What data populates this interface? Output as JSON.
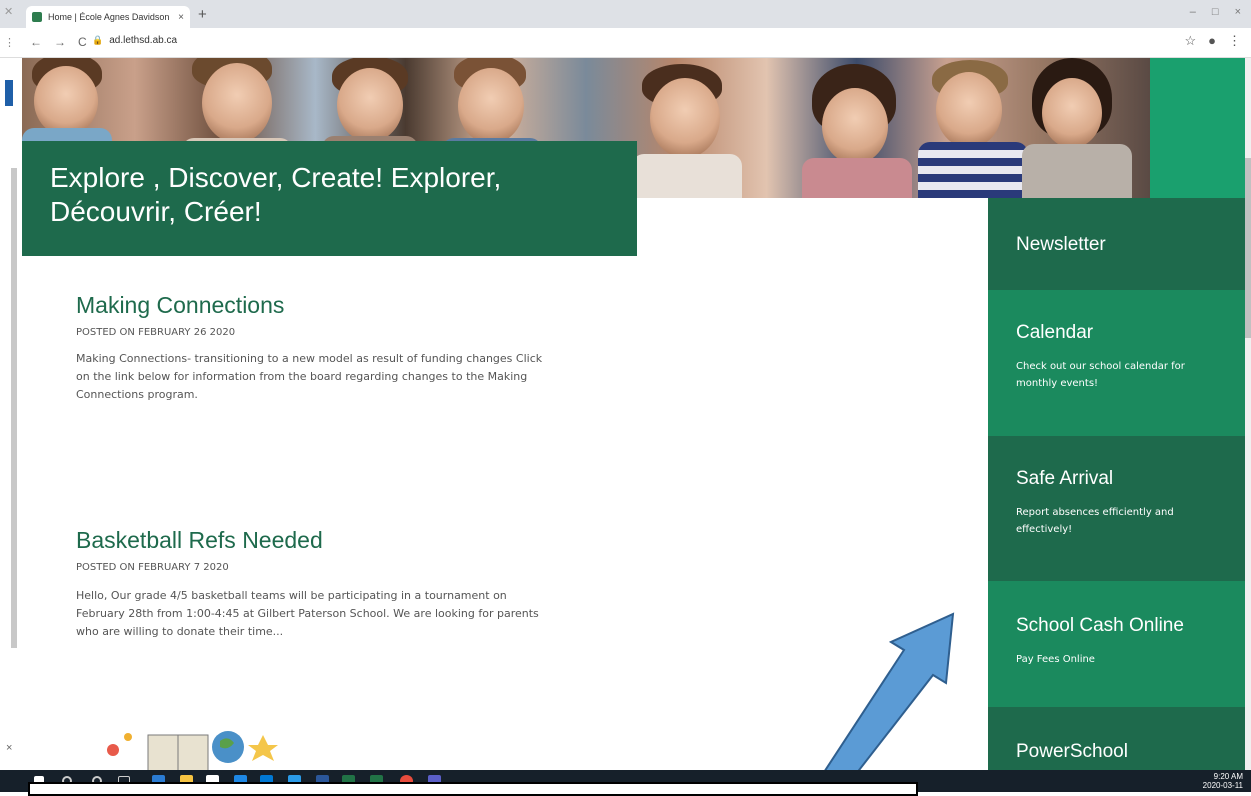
{
  "browser": {
    "tab_title": "Home | École Agnes Davidson",
    "tab_close": "×",
    "new_tab": "+",
    "url": "ad.lethsd.ab.ca",
    "window_controls": [
      "–",
      "□",
      "×"
    ]
  },
  "hero": {
    "banner_text": "Explore , Discover, Create! Explorer, Découvrir, Créer!"
  },
  "posts": [
    {
      "title": "Making Connections",
      "date": "POSTED ON FEBRUARY 26 2020",
      "excerpt": "Making Connections- transitioning to a new model as result of funding changes Click on the link below for information from the board regarding changes to the Making Connections program."
    },
    {
      "title": "Basketball Refs Needed",
      "date": "POSTED ON FEBRUARY 7 2020",
      "excerpt": "Hello, Our grade 4/5 basketball teams will be participating in a tournament on February 28th from 1:00-4:45 at Gilbert Paterson School. We are looking for parents who are willing to donate their time..."
    }
  ],
  "sidebar": {
    "items": [
      {
        "title": "Newsletter",
        "desc": "",
        "color": "#1e6a4c"
      },
      {
        "title": "Calendar",
        "desc": "Check out our school calendar for monthly events!",
        "color": "#1b8a5e"
      },
      {
        "title": "Safe Arrival",
        "desc": "Report absences efficiently and effectively!",
        "color": "#1e6a4c"
      },
      {
        "title": "School Cash Online",
        "desc": "Pay Fees Online",
        "color": "#1b8a5e"
      },
      {
        "title": "PowerSchool",
        "desc": "",
        "color": "#1e6a4c"
      }
    ]
  },
  "taskbar": {
    "time": "9:20 AM",
    "date": "2020-03-11"
  },
  "colors": {
    "dark_green": "#1e6a4c",
    "mid_green": "#1b8a5e",
    "bright_green": "#1aa06e",
    "arrow_blue": "#5b9bd5"
  }
}
